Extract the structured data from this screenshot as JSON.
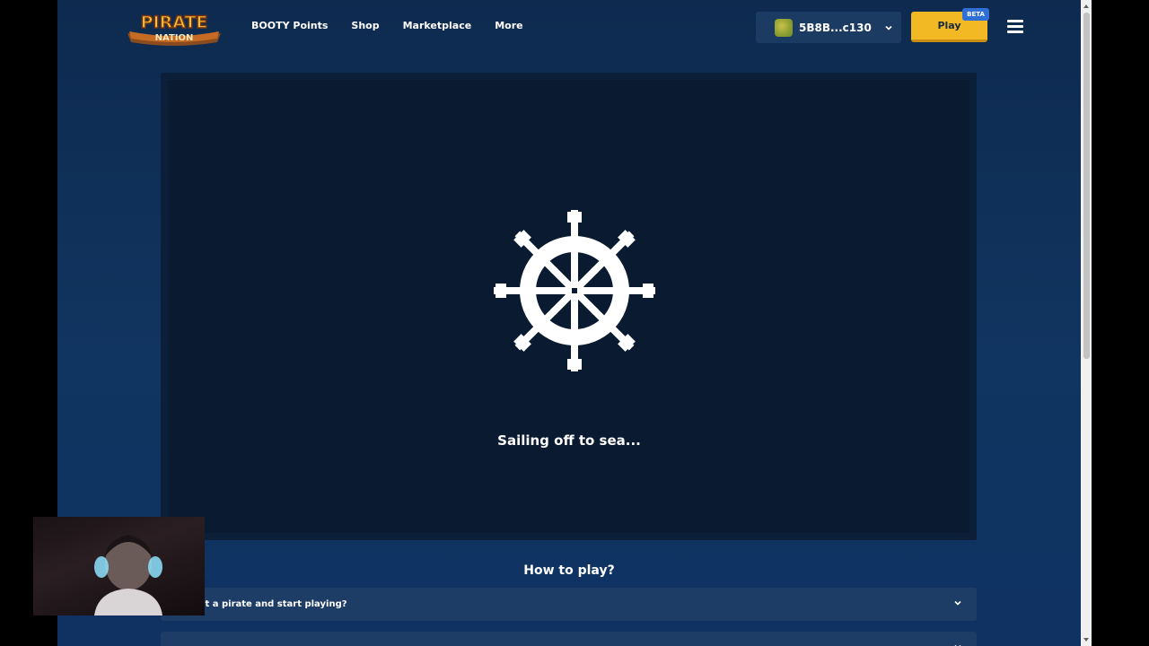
{
  "header": {
    "logo_text_top": "PIRATE",
    "logo_text_bottom": "NATION",
    "nav": [
      "BOOTY Points",
      "Shop",
      "Marketplace",
      "More"
    ],
    "wallet_address": "5B8B...c130",
    "play_label": "Play",
    "beta_label": "BETA"
  },
  "game": {
    "loading_text": "Sailing off to sea..."
  },
  "how_to_play": {
    "title": "How to play?",
    "questions": [
      "o I get a pirate and start playing?",
      ""
    ]
  },
  "colors": {
    "background": "#103560",
    "frame": "#0a1a30",
    "play_button": "#f2b925",
    "beta_badge": "#2f6fd6",
    "faq_row": "#1e3d66"
  }
}
